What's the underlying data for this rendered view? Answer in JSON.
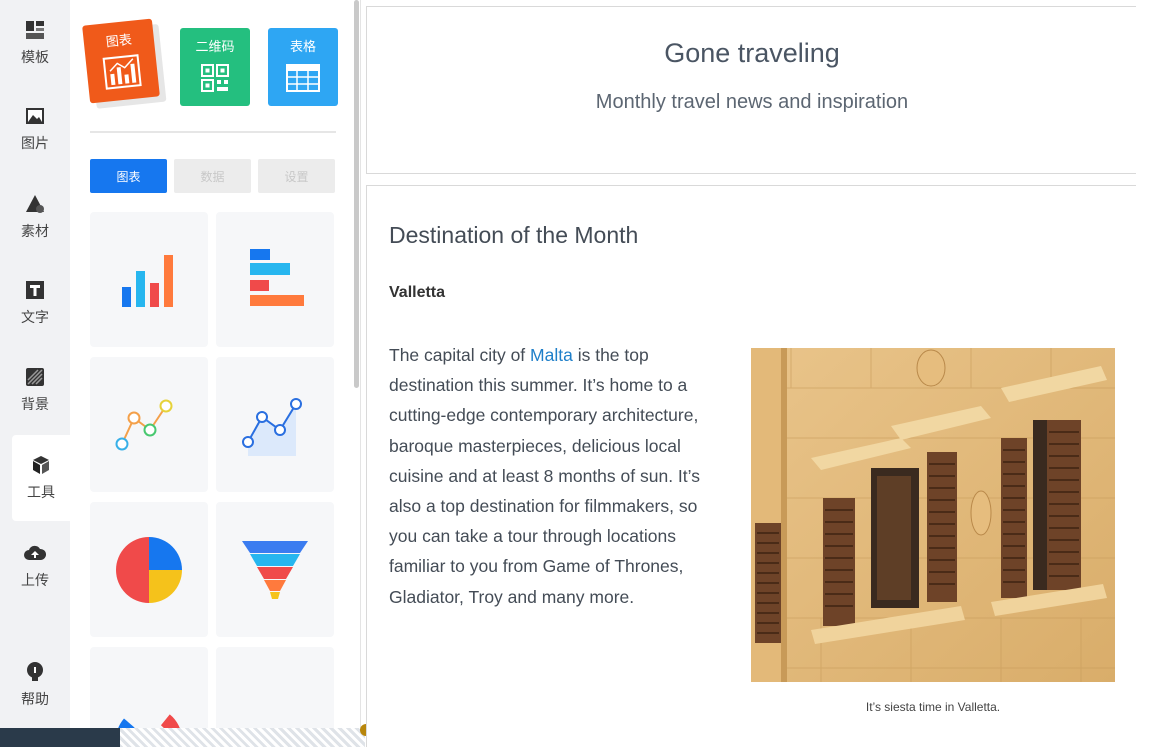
{
  "sidebar": {
    "items": [
      {
        "label": "模板",
        "icon": "template-icon"
      },
      {
        "label": "图片",
        "icon": "image-icon"
      },
      {
        "label": "素材",
        "icon": "shapes-icon"
      },
      {
        "label": "文字",
        "icon": "text-icon"
      },
      {
        "label": "背景",
        "icon": "background-icon"
      },
      {
        "label": "工具",
        "icon": "cube-icon",
        "active": true
      },
      {
        "label": "上传",
        "icon": "cloud-upload-icon"
      },
      {
        "label": "帮助",
        "icon": "lightbulb-icon"
      }
    ]
  },
  "tools": {
    "chart": "图表",
    "qrcode": "二维码",
    "table": "表格"
  },
  "panel_tabs": {
    "chart": "图表",
    "data": "数据",
    "settings": "设置"
  },
  "chart_types": [
    "bar-chart-icon",
    "horizontal-bar-chart-icon",
    "line-chart-icon",
    "area-line-chart-icon",
    "pie-chart-icon",
    "funnel-chart-icon",
    "donut-chart-icon",
    "stacked-area-chart-icon"
  ],
  "header": {
    "title": "Gone traveling",
    "subtitle": "Monthly travel news and inspiration"
  },
  "article": {
    "section_title": "Destination of the Month",
    "city": "Valletta",
    "body_before": "The capital city of ",
    "link": "Malta",
    "body_after": " is the top destination this summer. It’s home to a cutting-edge contemporary architecture, baroque masterpieces, delicious local cuisine and at least 8 months of sun. It’s also a top destination for filmmakers, so you can take a tour through locations familiar to you from Game of Thrones, Gladiator, Troy and many more.",
    "caption": "It’s siesta time in Valletta."
  },
  "colors": {
    "accent": "#1677ef",
    "link": "#1f7fc9",
    "chart_tool": "#f05a1a",
    "qr_tool": "#24bf7f",
    "table_tool": "#2ea6f3"
  }
}
